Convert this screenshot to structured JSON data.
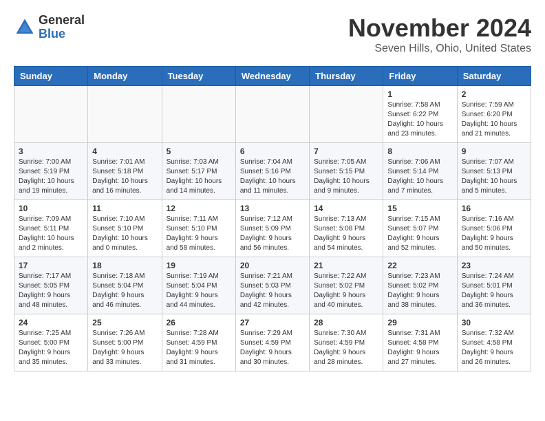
{
  "logo": {
    "general": "General",
    "blue": "Blue"
  },
  "header": {
    "month": "November 2024",
    "location": "Seven Hills, Ohio, United States"
  },
  "days_of_week": [
    "Sunday",
    "Monday",
    "Tuesday",
    "Wednesday",
    "Thursday",
    "Friday",
    "Saturday"
  ],
  "weeks": [
    [
      {
        "day": "",
        "info": ""
      },
      {
        "day": "",
        "info": ""
      },
      {
        "day": "",
        "info": ""
      },
      {
        "day": "",
        "info": ""
      },
      {
        "day": "",
        "info": ""
      },
      {
        "day": "1",
        "info": "Sunrise: 7:58 AM\nSunset: 6:22 PM\nDaylight: 10 hours and 23 minutes."
      },
      {
        "day": "2",
        "info": "Sunrise: 7:59 AM\nSunset: 6:20 PM\nDaylight: 10 hours and 21 minutes."
      }
    ],
    [
      {
        "day": "3",
        "info": "Sunrise: 7:00 AM\nSunset: 5:19 PM\nDaylight: 10 hours and 19 minutes."
      },
      {
        "day": "4",
        "info": "Sunrise: 7:01 AM\nSunset: 5:18 PM\nDaylight: 10 hours and 16 minutes."
      },
      {
        "day": "5",
        "info": "Sunrise: 7:03 AM\nSunset: 5:17 PM\nDaylight: 10 hours and 14 minutes."
      },
      {
        "day": "6",
        "info": "Sunrise: 7:04 AM\nSunset: 5:16 PM\nDaylight: 10 hours and 11 minutes."
      },
      {
        "day": "7",
        "info": "Sunrise: 7:05 AM\nSunset: 5:15 PM\nDaylight: 10 hours and 9 minutes."
      },
      {
        "day": "8",
        "info": "Sunrise: 7:06 AM\nSunset: 5:14 PM\nDaylight: 10 hours and 7 minutes."
      },
      {
        "day": "9",
        "info": "Sunrise: 7:07 AM\nSunset: 5:13 PM\nDaylight: 10 hours and 5 minutes."
      }
    ],
    [
      {
        "day": "10",
        "info": "Sunrise: 7:09 AM\nSunset: 5:11 PM\nDaylight: 10 hours and 2 minutes."
      },
      {
        "day": "11",
        "info": "Sunrise: 7:10 AM\nSunset: 5:10 PM\nDaylight: 10 hours and 0 minutes."
      },
      {
        "day": "12",
        "info": "Sunrise: 7:11 AM\nSunset: 5:10 PM\nDaylight: 9 hours and 58 minutes."
      },
      {
        "day": "13",
        "info": "Sunrise: 7:12 AM\nSunset: 5:09 PM\nDaylight: 9 hours and 56 minutes."
      },
      {
        "day": "14",
        "info": "Sunrise: 7:13 AM\nSunset: 5:08 PM\nDaylight: 9 hours and 54 minutes."
      },
      {
        "day": "15",
        "info": "Sunrise: 7:15 AM\nSunset: 5:07 PM\nDaylight: 9 hours and 52 minutes."
      },
      {
        "day": "16",
        "info": "Sunrise: 7:16 AM\nSunset: 5:06 PM\nDaylight: 9 hours and 50 minutes."
      }
    ],
    [
      {
        "day": "17",
        "info": "Sunrise: 7:17 AM\nSunset: 5:05 PM\nDaylight: 9 hours and 48 minutes."
      },
      {
        "day": "18",
        "info": "Sunrise: 7:18 AM\nSunset: 5:04 PM\nDaylight: 9 hours and 46 minutes."
      },
      {
        "day": "19",
        "info": "Sunrise: 7:19 AM\nSunset: 5:04 PM\nDaylight: 9 hours and 44 minutes."
      },
      {
        "day": "20",
        "info": "Sunrise: 7:21 AM\nSunset: 5:03 PM\nDaylight: 9 hours and 42 minutes."
      },
      {
        "day": "21",
        "info": "Sunrise: 7:22 AM\nSunset: 5:02 PM\nDaylight: 9 hours and 40 minutes."
      },
      {
        "day": "22",
        "info": "Sunrise: 7:23 AM\nSunset: 5:02 PM\nDaylight: 9 hours and 38 minutes."
      },
      {
        "day": "23",
        "info": "Sunrise: 7:24 AM\nSunset: 5:01 PM\nDaylight: 9 hours and 36 minutes."
      }
    ],
    [
      {
        "day": "24",
        "info": "Sunrise: 7:25 AM\nSunset: 5:00 PM\nDaylight: 9 hours and 35 minutes."
      },
      {
        "day": "25",
        "info": "Sunrise: 7:26 AM\nSunset: 5:00 PM\nDaylight: 9 hours and 33 minutes."
      },
      {
        "day": "26",
        "info": "Sunrise: 7:28 AM\nSunset: 4:59 PM\nDaylight: 9 hours and 31 minutes."
      },
      {
        "day": "27",
        "info": "Sunrise: 7:29 AM\nSunset: 4:59 PM\nDaylight: 9 hours and 30 minutes."
      },
      {
        "day": "28",
        "info": "Sunrise: 7:30 AM\nSunset: 4:59 PM\nDaylight: 9 hours and 28 minutes."
      },
      {
        "day": "29",
        "info": "Sunrise: 7:31 AM\nSunset: 4:58 PM\nDaylight: 9 hours and 27 minutes."
      },
      {
        "day": "30",
        "info": "Sunrise: 7:32 AM\nSunset: 4:58 PM\nDaylight: 9 hours and 26 minutes."
      }
    ]
  ]
}
